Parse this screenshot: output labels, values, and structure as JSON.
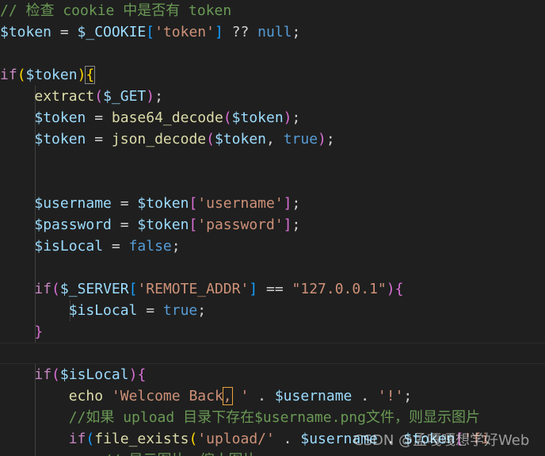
{
  "editor": {
    "lines": [
      [
        [
          "// 检查 cookie 中是否有 token",
          "comment"
        ]
      ],
      [
        [
          "$token",
          "var"
        ],
        [
          " = ",
          "op"
        ],
        [
          "$_COOKIE",
          "var"
        ],
        [
          "[",
          "brkt3"
        ],
        [
          "'token'",
          "str"
        ],
        [
          "]",
          "brkt3"
        ],
        [
          " ?? ",
          "op"
        ],
        [
          "null",
          "const"
        ],
        [
          ";",
          "op"
        ]
      ],
      [],
      [
        [
          "if",
          "key"
        ],
        [
          "(",
          "brkt1"
        ],
        [
          "$token",
          "var"
        ],
        [
          ")",
          "brkt1"
        ],
        [
          "{",
          "brkt1"
        ]
      ],
      [
        [
          "    "
        ],
        [
          "extract",
          "fn"
        ],
        [
          "(",
          "brkt2"
        ],
        [
          "$_GET",
          "var"
        ],
        [
          ")",
          "brkt2"
        ],
        [
          ";",
          "op"
        ]
      ],
      [
        [
          "    "
        ],
        [
          "$token",
          "var"
        ],
        [
          " = ",
          "op"
        ],
        [
          "base64_decode",
          "fn"
        ],
        [
          "(",
          "brkt2"
        ],
        [
          "$token",
          "var"
        ],
        [
          ")",
          "brkt2"
        ],
        [
          ";",
          "op"
        ]
      ],
      [
        [
          "    "
        ],
        [
          "$token",
          "var"
        ],
        [
          " = ",
          "op"
        ],
        [
          "json_decode",
          "fn"
        ],
        [
          "(",
          "brkt2"
        ],
        [
          "$token",
          "var"
        ],
        [
          ", ",
          "op"
        ],
        [
          "true",
          "const"
        ],
        [
          ")",
          "brkt2"
        ],
        [
          ";",
          "op"
        ]
      ],
      [],
      [],
      [
        [
          "    "
        ],
        [
          "$username",
          "var"
        ],
        [
          " = ",
          "op"
        ],
        [
          "$token",
          "var"
        ],
        [
          "[",
          "brkt2"
        ],
        [
          "'username'",
          "str"
        ],
        [
          "]",
          "brkt2"
        ],
        [
          ";",
          "op"
        ]
      ],
      [
        [
          "    "
        ],
        [
          "$password",
          "var"
        ],
        [
          " = ",
          "op"
        ],
        [
          "$token",
          "var"
        ],
        [
          "[",
          "brkt2"
        ],
        [
          "'password'",
          "str"
        ],
        [
          "]",
          "brkt2"
        ],
        [
          ";",
          "op"
        ]
      ],
      [
        [
          "    "
        ],
        [
          "$isLocal",
          "var"
        ],
        [
          " = ",
          "op"
        ],
        [
          "false",
          "const"
        ],
        [
          ";",
          "op"
        ]
      ],
      [],
      [
        [
          "    "
        ],
        [
          "if",
          "key"
        ],
        [
          "(",
          "brkt2"
        ],
        [
          "$_SERVER",
          "var"
        ],
        [
          "[",
          "brkt3"
        ],
        [
          "'REMOTE_ADDR'",
          "str"
        ],
        [
          "]",
          "brkt3"
        ],
        [
          " == ",
          "op"
        ],
        [
          "\"127.0.0.1\"",
          "str"
        ],
        [
          ")",
          "brkt2"
        ],
        [
          "{",
          "brkt2"
        ]
      ],
      [
        [
          "        "
        ],
        [
          "$isLocal",
          "var"
        ],
        [
          " = ",
          "op"
        ],
        [
          "true",
          "const"
        ],
        [
          ";",
          "op"
        ]
      ],
      [
        [
          "    "
        ],
        [
          "}",
          "brkt2"
        ]
      ],
      [],
      [
        [
          "    "
        ],
        [
          "if",
          "key"
        ],
        [
          "(",
          "brkt2"
        ],
        [
          "$isLocal",
          "var"
        ],
        [
          ")",
          "brkt2"
        ],
        [
          "{",
          "brkt2"
        ]
      ],
      [
        [
          "        "
        ],
        [
          "echo",
          "fn"
        ],
        [
          " ",
          "op"
        ],
        [
          "'Welcome Back",
          "str"
        ],
        [
          ",",
          "str-sel"
        ],
        [
          " ' ",
          "str"
        ],
        [
          ". ",
          "op"
        ],
        [
          "$username",
          "var"
        ],
        [
          " . ",
          "op"
        ],
        [
          "'!'",
          "str"
        ],
        [
          ";",
          "op"
        ]
      ],
      [
        [
          "        "
        ],
        [
          "//如果 upload 目录下存在$username.png文件，则显示图片",
          "comment"
        ]
      ],
      [
        [
          "        "
        ],
        [
          "if",
          "key"
        ],
        [
          "(",
          "brkt3"
        ],
        [
          "file_exists",
          "fn"
        ],
        [
          "(",
          "brkt1"
        ],
        [
          "'upload/'",
          "str"
        ],
        [
          " . ",
          "op"
        ],
        [
          "$username",
          "var"
        ],
        [
          " . ",
          "op"
        ],
        [
          "$token",
          "var"
        ],
        [
          "[",
          "brkt2"
        ],
        [
          "'fi",
          "str"
        ]
      ],
      [
        [
          "            "
        ],
        [
          "// 显示图片，缩小图片",
          "comment"
        ]
      ]
    ],
    "watermark": "CSDN @孟嘎嘎想学好Web"
  }
}
